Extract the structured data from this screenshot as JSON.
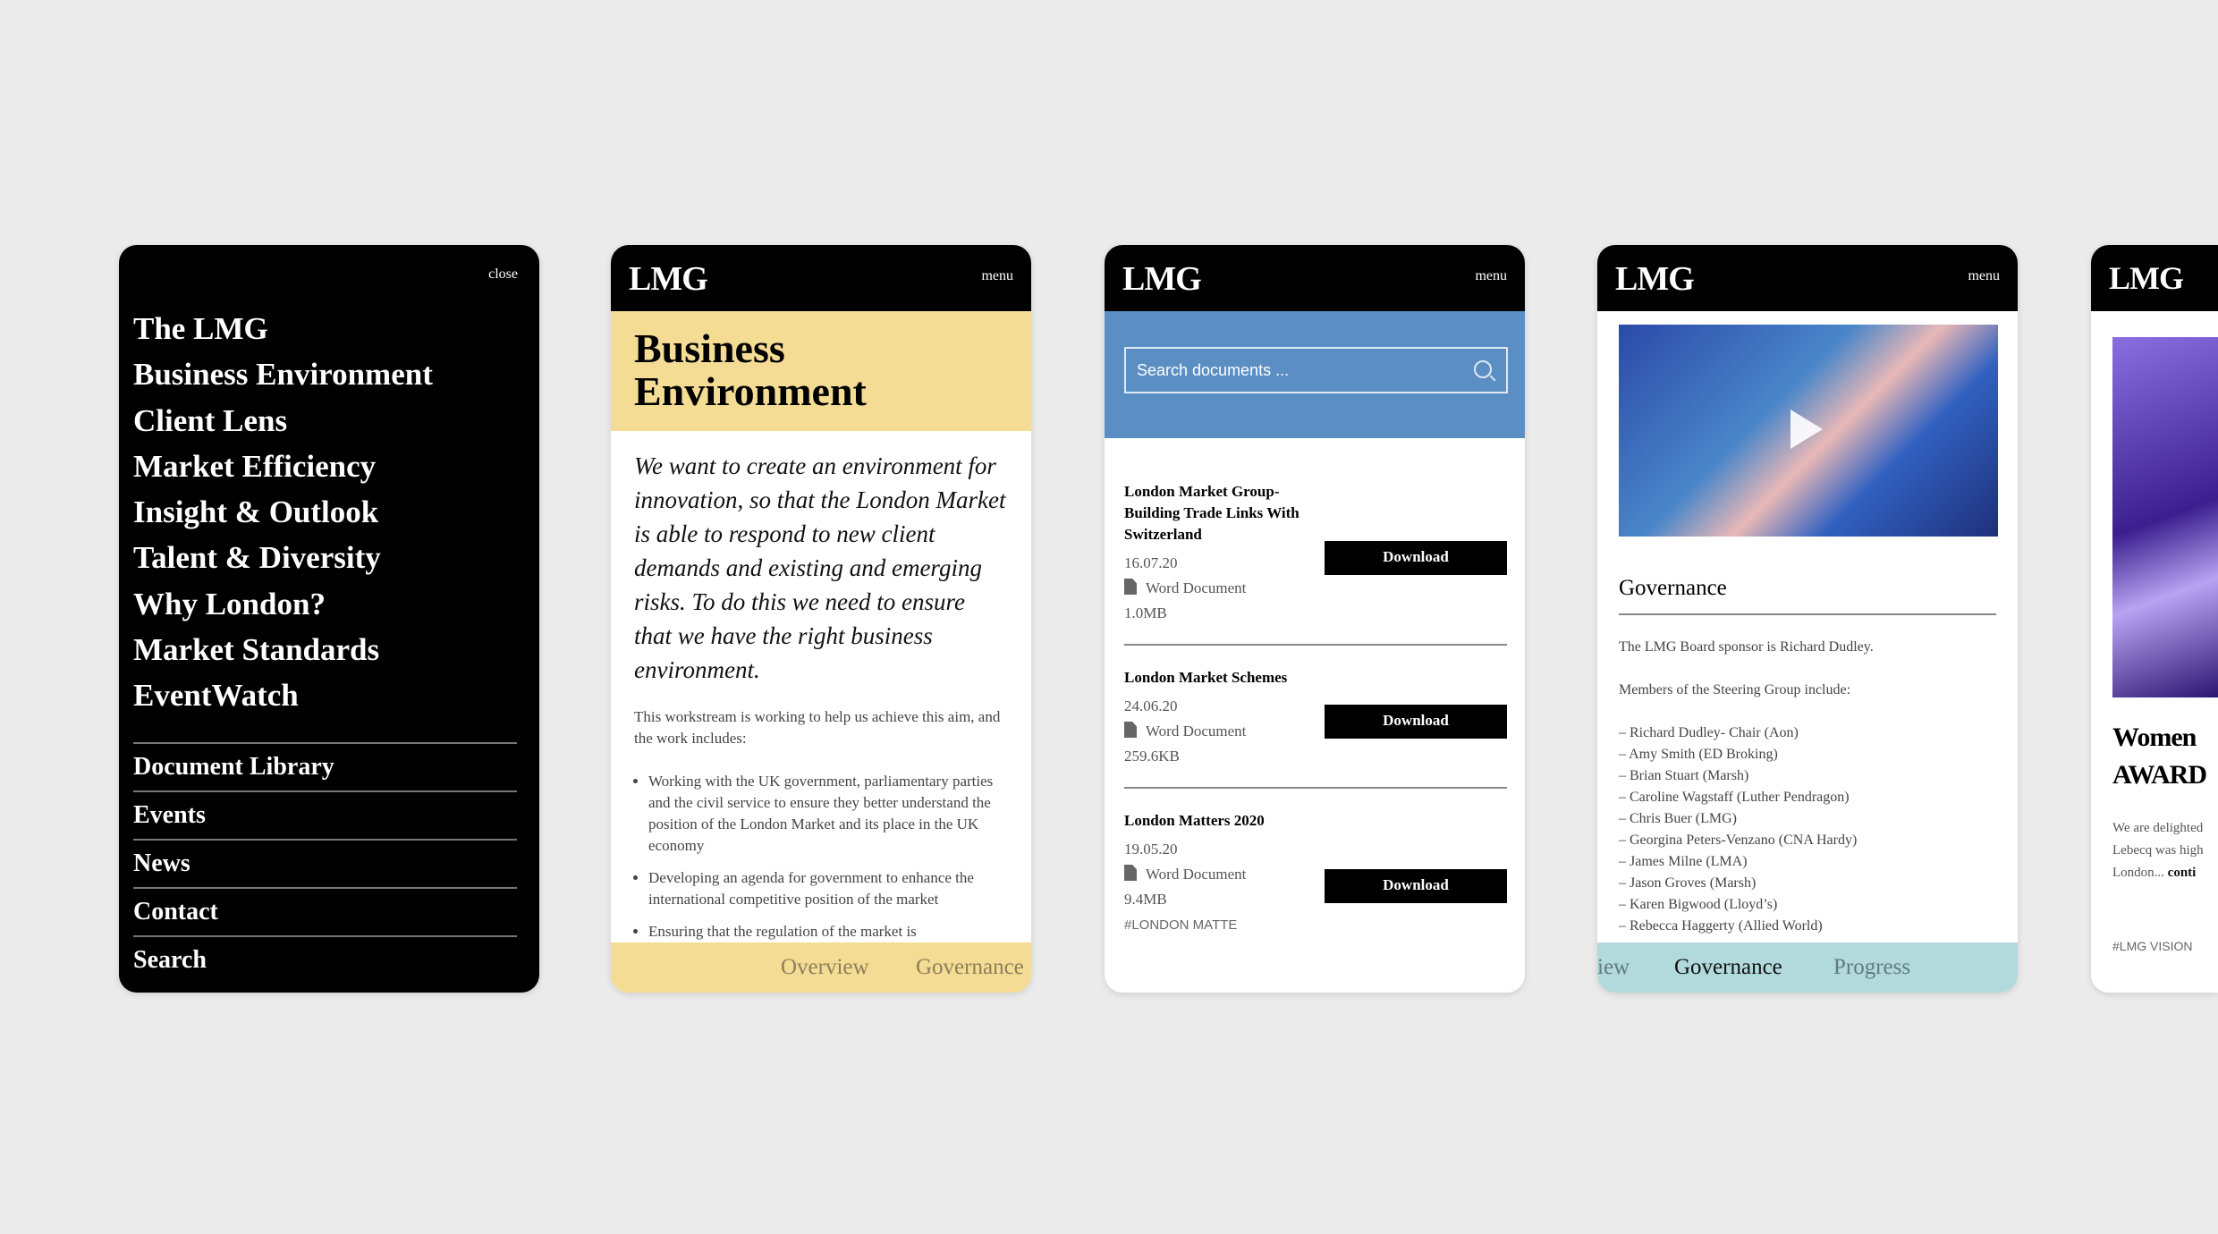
{
  "colors": {
    "background": "#ebebeb",
    "header": "#000000",
    "business_yellow": "#f5dc95",
    "search_blue": "#5b8fc4",
    "governance_teal": "#b2d9dc"
  },
  "brand": "LMG",
  "menu_label": "menu",
  "nav_panel": {
    "close_label": "close",
    "main_items": [
      "The LMG",
      "Business Environment",
      "Client Lens",
      "Market Efficiency",
      "Insight & Outlook",
      "Talent & Diversity",
      "Why London?",
      "Market Standards",
      "EventWatch"
    ],
    "secondary_items": [
      "Document Library",
      "Events",
      "News",
      "Contact",
      "Search"
    ]
  },
  "business_panel": {
    "title": "Business Environment",
    "intro": "We want to create an environment for innovation, so that the London Market is able to respond to new client demands and existing and emerging risks. To do this we need to ensure that we have the right business environment.",
    "body": "This workstream is working to help us achieve this aim, and the work includes:",
    "bullets": [
      "Working with the UK government, parliamentary parties and the civil service to ensure they better understand the position of the London Market and its place in the UK economy",
      "Developing an agenda for government to enhance the international competitive position of the market",
      "Ensuring that the regulation of the market is"
    ],
    "tabs": [
      "Overview",
      "Governance"
    ]
  },
  "documents_panel": {
    "search_placeholder": "Search documents ...",
    "download_label": "Download",
    "documents": [
      {
        "title": "London Market Group- Building Trade Links With Switzerland",
        "date": "16.07.20",
        "type": "Word Document",
        "size": "1.0MB"
      },
      {
        "title": "London Market Schemes",
        "date": "24.06.20",
        "type": "Word Document",
        "size": "259.6KB"
      },
      {
        "title": "London Matters 2020",
        "date": "19.05.20",
        "type": "Word Document",
        "size": "9.4MB",
        "tag": "#LONDON MATTE"
      }
    ]
  },
  "governance_panel": {
    "heading": "Governance",
    "sponsor": "The LMG Board sponsor is Richard Dudley.",
    "members_intro": "Members of the Steering Group include:",
    "members": [
      "– Richard Dudley- Chair (Aon)",
      "– Amy Smith (ED Broking)",
      "– Brian Stuart (Marsh)",
      "– Caroline Wagstaff (Luther Pendragon)",
      "– Chris Buer (LMG)",
      "– Georgina Peters-Venzano (CNA Hardy)",
      "– James Milne (LMA)",
      "– Jason Groves (Marsh)",
      "– Karen Bigwood (Lloyd’s)",
      "– Rebecca Haggerty (Allied World)"
    ],
    "tabs": [
      "iew",
      "Governance",
      "Progress"
    ]
  },
  "news_panel": {
    "title_line1": "Women",
    "title_line2": "AWARD",
    "excerpt_line1": "We are delighted",
    "excerpt_line2": "Lebecq was high",
    "excerpt_line3": "London...",
    "continue": "conti",
    "tag": "#LMG VISION"
  }
}
